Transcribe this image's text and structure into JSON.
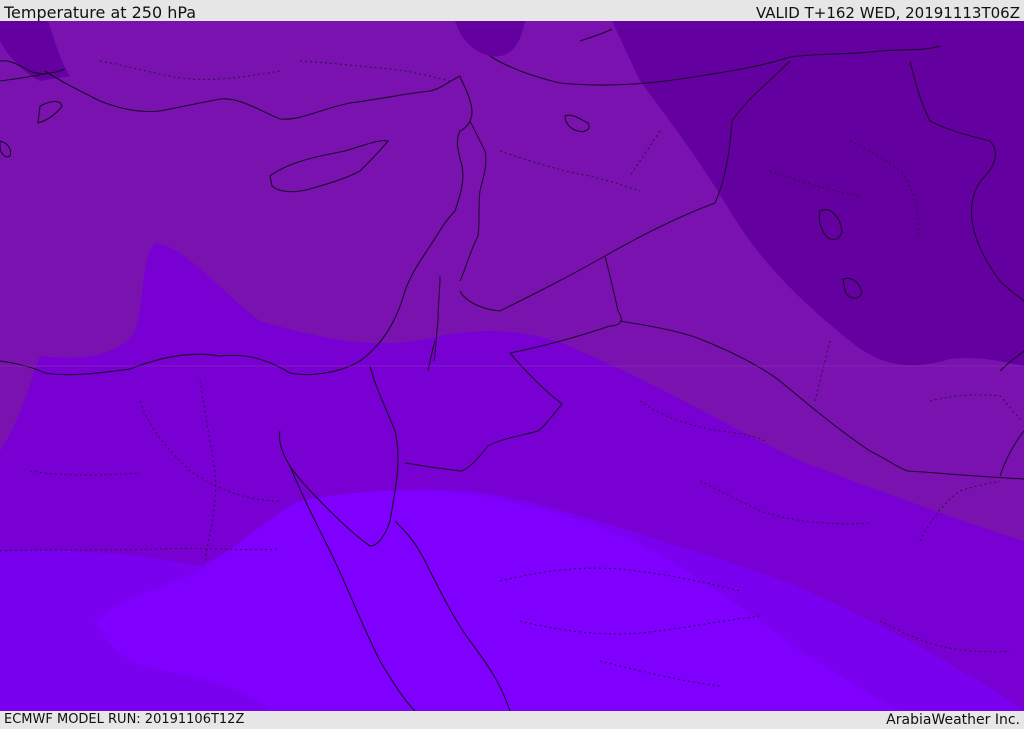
{
  "header": {
    "title": "Temperature at 250 hPa",
    "valid": "VALID T+162 WED, 20191113T06Z"
  },
  "footer": {
    "model_run": "ECMWF MODEL RUN: 20191106T12Z",
    "credit": "ArabiaWeather Inc."
  },
  "map": {
    "region": "Eastern Mediterranean & Middle East",
    "field_colors": {
      "coldest": "#6400a0",
      "cold": "#7a12b0",
      "mid": "#7800d2",
      "warm": "#7a00f0",
      "warmest": "#8000ff"
    }
  }
}
